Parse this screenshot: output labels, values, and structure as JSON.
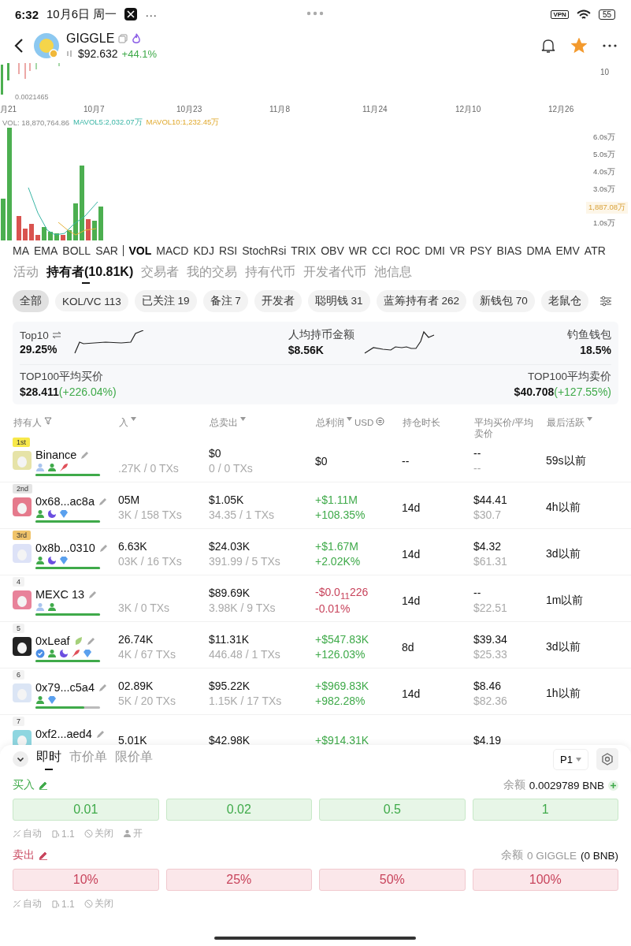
{
  "status_bar": {
    "time": "6:32",
    "date": "10月6日 周一",
    "more": "···",
    "vpn": "VPN",
    "battery": "55"
  },
  "token": {
    "name": "GIGGLE",
    "price": "$92.632",
    "change": "+44.1%",
    "favorite": true
  },
  "chart": {
    "price_axis": "10",
    "low_price": "0.0021465",
    "dates": [
      "月21",
      "10月7",
      "10月23",
      "11月8",
      "11月24",
      "12月10",
      "12月26"
    ],
    "vol": "VOL: 18,870,764.86",
    "mavol5": "MAVOL5:2,032.07万",
    "mavol10": "MAVOL10:1,232.45万",
    "vol_axis": [
      "6.0s万",
      "5.0s万",
      "4.0s万",
      "3.0s万",
      "1.0s万"
    ],
    "current_vol": "1,887.08万"
  },
  "indicators": [
    {
      "label": "MA",
      "selected": false
    },
    {
      "label": "EMA",
      "selected": false
    },
    {
      "label": "BOLL",
      "selected": false
    },
    {
      "label": "SAR",
      "selected": false
    },
    {
      "label": "VOL",
      "selected": true
    },
    {
      "label": "MACD",
      "selected": false
    },
    {
      "label": "KDJ",
      "selected": false
    },
    {
      "label": "RSI",
      "selected": false
    },
    {
      "label": "StochRsi",
      "selected": false
    },
    {
      "label": "TRIX",
      "selected": false
    },
    {
      "label": "OBV",
      "selected": false
    },
    {
      "label": "WR",
      "selected": false
    },
    {
      "label": "CCI",
      "selected": false
    },
    {
      "label": "ROC",
      "selected": false
    },
    {
      "label": "DMI",
      "selected": false
    },
    {
      "label": "VR",
      "selected": false
    },
    {
      "label": "PSY",
      "selected": false
    },
    {
      "label": "BIAS",
      "selected": false
    },
    {
      "label": "DMA",
      "selected": false
    },
    {
      "label": "EMV",
      "selected": false
    },
    {
      "label": "ATR",
      "selected": false
    }
  ],
  "tabs": [
    {
      "label": "活动",
      "selected": false
    },
    {
      "label": "持有者(10.81K)",
      "selected": true
    },
    {
      "label": "交易者",
      "selected": false
    },
    {
      "label": "我的交易",
      "selected": false
    },
    {
      "label": "持有代币",
      "selected": false
    },
    {
      "label": "开发者代币",
      "selected": false
    },
    {
      "label": "池信息",
      "selected": false
    }
  ],
  "filters": [
    {
      "label": "全部",
      "selected": true
    },
    {
      "label": "KOL/VC 113",
      "selected": false
    },
    {
      "label": "已关注 19",
      "selected": false
    },
    {
      "label": "备注 7",
      "selected": false
    },
    {
      "label": "开发者",
      "selected": false
    },
    {
      "label": "聪明钱 31",
      "selected": false
    },
    {
      "label": "蓝筹持有者 262",
      "selected": false
    },
    {
      "label": "新钱包 70",
      "selected": false
    },
    {
      "label": "老鼠仓",
      "selected": false
    }
  ],
  "stats": {
    "top10_label": "Top10",
    "top10": "29.25%",
    "avg_hold_label": "人均持币金额",
    "avg_hold": "$8.56K",
    "phishing_label": "钓鱼钱包",
    "phishing": "18.5%",
    "buy_label": "TOP100平均买价",
    "buy": "$28.411",
    "buy_change": "(+226.04%)",
    "sell_label": "TOP100平均卖价",
    "sell": "$40.708",
    "sell_change": "(+127.55%)"
  },
  "table": {
    "columns": [
      {
        "label": "持有人",
        "kind": "filter"
      },
      {
        "label": "入",
        "kind": "sort"
      },
      {
        "label": "总卖出",
        "kind": "sort"
      },
      {
        "label": "总利润",
        "kind": "sort",
        "unit": "USD"
      },
      {
        "label": "持仓时长",
        "kind": "plain"
      },
      {
        "label": "平均买价/平均卖价",
        "kind": "plain"
      },
      {
        "label": "最后活跃",
        "kind": "sort"
      }
    ],
    "rows": [
      {
        "rank": {
          "label": "1st",
          "kind": "gold"
        },
        "name": "Binance",
        "leaf_badge": false,
        "color": "#e6e3a8",
        "tags": [
          {
            "kind": "person_light"
          },
          {
            "kind": "person"
          },
          {
            "kind": "fish"
          }
        ],
        "level": 1,
        "buy": {
          "sub": ".27K / 0 TXs"
        },
        "sell": [
          "$0",
          "0 / 0 TXs"
        ],
        "profit": {
          "kind": "flat",
          "lines": [
            "$0"
          ]
        },
        "hold": "--",
        "avg": [
          "--",
          "--"
        ],
        "last": "59s以前"
      },
      {
        "rank": {
          "label": "2nd",
          "kind": "silver"
        },
        "name": "0x68...ac8a",
        "leaf_badge": false,
        "color": "#e57a8c",
        "tags": [
          {
            "kind": "person"
          },
          {
            "kind": "moon"
          },
          {
            "kind": "diamond"
          }
        ],
        "level": 1,
        "buy": {
          "top": "05M",
          "sub": "3K / 158 TXs"
        },
        "sell": [
          "$1.05K",
          "34.35 / 1 TXs"
        ],
        "profit": {
          "kind": "up",
          "lines": [
            "+$1.11M",
            "+108.35%"
          ]
        },
        "hold": "14d",
        "avg": [
          "$44.41",
          "$30.7"
        ],
        "last": "4h以前"
      },
      {
        "rank": {
          "label": "3rd",
          "kind": "bronze"
        },
        "name": "0x8b...0310",
        "leaf_badge": false,
        "color": "#dde2f7",
        "tags": [
          {
            "kind": "person"
          },
          {
            "kind": "moon"
          },
          {
            "kind": "diamond"
          }
        ],
        "level": 1,
        "buy": {
          "top": "6.63K",
          "sub": "03K / 16 TXs"
        },
        "sell": [
          "$24.03K",
          "391.99 / 5 TXs"
        ],
        "profit": {
          "kind": "up",
          "lines": [
            "+$1.67M",
            "+2.02K%"
          ]
        },
        "hold": "14d",
        "avg": [
          "$4.32",
          "$61.31"
        ],
        "last": "3d以前"
      },
      {
        "rank": {
          "label": "4",
          "kind": "plain"
        },
        "name": "MEXC 13",
        "leaf_badge": false,
        "color": "#e8829a",
        "tags": [
          {
            "kind": "person_light"
          },
          {
            "kind": "person"
          }
        ],
        "level": 1,
        "buy": {
          "sub": "3K / 0 TXs"
        },
        "sell": [
          "$89.69K",
          "3.98K / 9 TXs"
        ],
        "profit": {
          "kind": "down",
          "lines": [
            "-$0.0$_{11}$226",
            "-0.01%"
          ]
        },
        "hold": "14d",
        "avg": [
          "--",
          "$22.51"
        ],
        "last": "1m以前"
      },
      {
        "rank": {
          "label": "5",
          "kind": "plain"
        },
        "name": "0xLeaf",
        "leaf_badge": true,
        "color": "#222222",
        "tags": [
          {
            "kind": "verified"
          },
          {
            "kind": "person"
          },
          {
            "kind": "moon"
          },
          {
            "kind": "fish"
          },
          {
            "kind": "diamond"
          }
        ],
        "level": 1,
        "buy": {
          "top": "26.74K",
          "sub": "4K / 67 TXs"
        },
        "sell": [
          "$11.31K",
          "446.48 / 1 TXs"
        ],
        "profit": {
          "kind": "up",
          "lines": [
            "+$547.83K",
            "+126.03%"
          ]
        },
        "hold": "8d",
        "avg": [
          "$39.34",
          "$25.33"
        ],
        "last": "3d以前"
      },
      {
        "rank": {
          "label": "6",
          "kind": "plain"
        },
        "name": "0x79...c5a4",
        "leaf_badge": false,
        "color": "#dbe5f5",
        "tags": [
          {
            "kind": "person"
          },
          {
            "kind": "diamond"
          }
        ],
        "level": 0.75,
        "buy": {
          "top": "02.89K",
          "sub": "5K / 20 TXs"
        },
        "sell": [
          "$95.22K",
          "1.15K / 17 TXs"
        ],
        "profit": {
          "kind": "up",
          "lines": [
            "+$969.83K",
            "+982.28%"
          ]
        },
        "hold": "14d",
        "avg": [
          "$8.46",
          "$82.36"
        ],
        "last": "1h以前"
      },
      {
        "rank": {
          "label": "7",
          "kind": "plain"
        },
        "name": "0xf2...aed4",
        "leaf_badge": false,
        "color": "#8fd6e0",
        "buy": {
          "top": "5.01K"
        },
        "sell": [
          "$42.98K"
        ],
        "profit": {
          "kind": "up",
          "lines": [
            "+$914.31K"
          ]
        },
        "avg": [
          "$4.19"
        ]
      }
    ]
  },
  "trade": {
    "tabs": [
      {
        "label": "即时",
        "selected": true
      },
      {
        "label": "市价单",
        "selected": false
      },
      {
        "label": "限价单",
        "selected": false
      }
    ],
    "preset": "P1",
    "sides": [
      {
        "kind": "buy",
        "label": "买入",
        "balance": [
          {
            "text": "余额",
            "muted": true
          },
          {
            "text": "0.0029789 BNB",
            "muted": false
          }
        ],
        "can_add": true,
        "amounts": [
          "0.01",
          "0.02",
          "0.5",
          "1"
        ],
        "options": [
          {
            "kind": "auto",
            "label": "自动"
          },
          {
            "kind": "gas",
            "label": "1.1"
          },
          {
            "kind": "shield",
            "label": "关闭"
          },
          {
            "kind": "person",
            "label": "开"
          }
        ]
      },
      {
        "kind": "sell",
        "label": "卖出",
        "balance": [
          {
            "text": "余额",
            "muted": true
          },
          {
            "text": "0 GIGGLE",
            "muted": true
          },
          {
            "text": "(0 BNB)",
            "muted": false
          }
        ],
        "can_add": false,
        "amounts": [
          "10%",
          "25%",
          "50%",
          "100%"
        ],
        "options": [
          {
            "kind": "auto",
            "label": "自动"
          },
          {
            "kind": "gas",
            "label": "1.1"
          },
          {
            "kind": "shield",
            "label": "关闭"
          }
        ]
      }
    ]
  }
}
